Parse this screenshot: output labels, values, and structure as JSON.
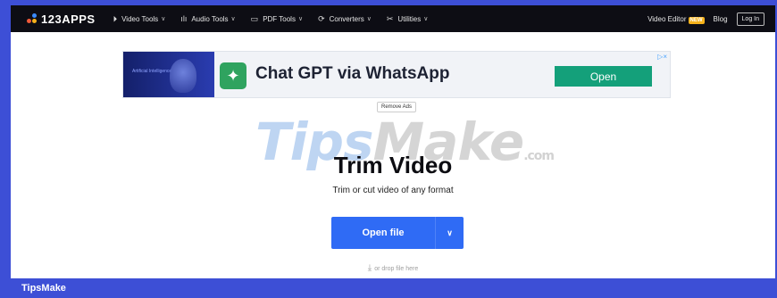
{
  "brand": {
    "name": "123APPS"
  },
  "nav": [
    {
      "label": "Video Tools",
      "icon": "video-icon",
      "glyph": "⏵"
    },
    {
      "label": "Audio Tools",
      "icon": "waveform-icon",
      "glyph": "ılı"
    },
    {
      "label": "PDF Tools",
      "icon": "document-icon",
      "glyph": "▭"
    },
    {
      "label": "Converters",
      "icon": "refresh-icon",
      "glyph": "⟳"
    },
    {
      "label": "Utilities",
      "icon": "tools-icon",
      "glyph": "✂"
    }
  ],
  "topbar_right": {
    "video_editor": "Video Editor",
    "new_badge": "NEW",
    "blog": "Blog",
    "login": "Log In"
  },
  "ad": {
    "left_text": "Artificial Intelligence",
    "title": "Chat GPT via WhatsApp",
    "cta": "Open",
    "marker": "▷×",
    "remove": "Remove Ads"
  },
  "watermark": {
    "part1": "Tips",
    "part2": "Make",
    "suffix": ".com"
  },
  "main": {
    "title": "Trim Video",
    "subtitle": "Trim or cut video of any format",
    "open_file": "Open file",
    "drop_hint": "or drop file here"
  },
  "footer": {
    "label": "TipsMake"
  },
  "colors": {
    "accent": "#2f6bf5",
    "topbar": "#0d0d14",
    "frame": "#3d4fd6",
    "ad_cta": "#14a07a",
    "badge": "#f6b21b"
  }
}
